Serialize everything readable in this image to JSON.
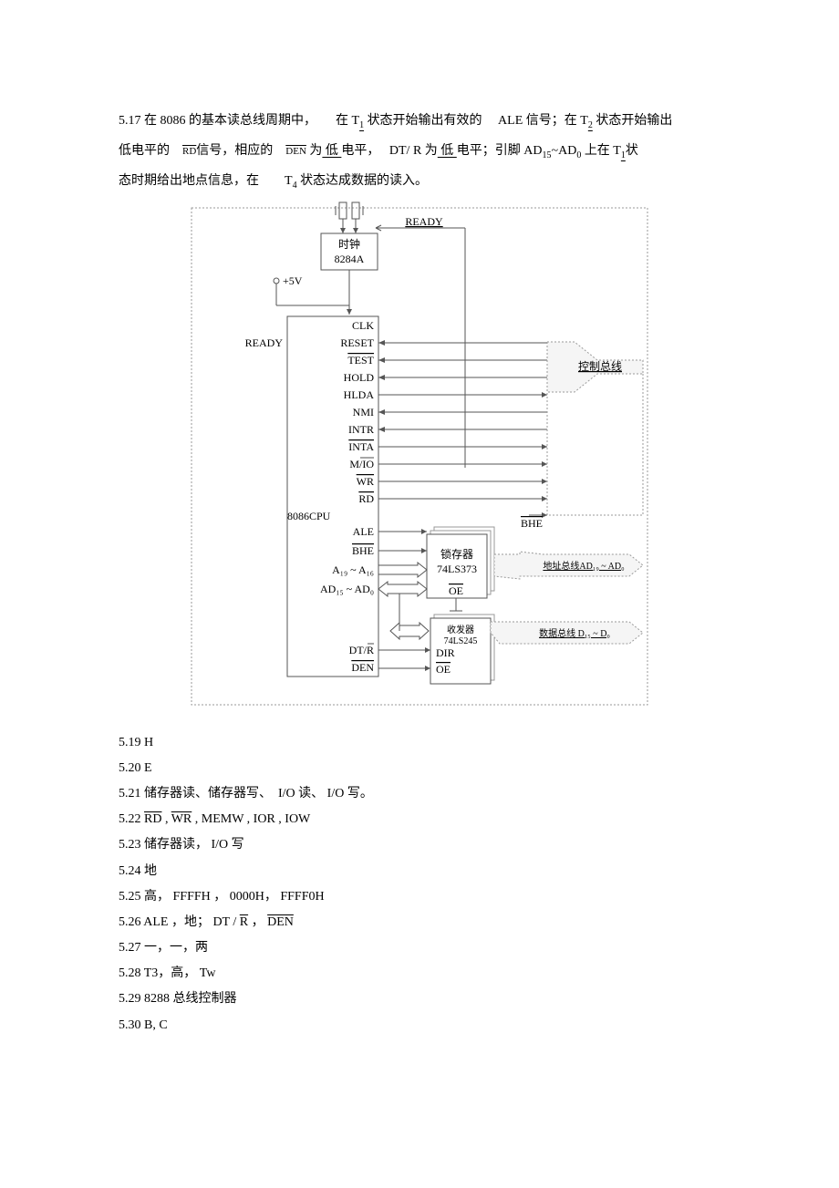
{
  "q517": {
    "prefix": "5.17 在 8086 的基本读总线周期中，　　在 T",
    "t1_sub": "1",
    "mid1": " 状态开始输出有效的　  ALE 信号；在 T",
    "t2_sub": "2",
    "mid1b": " 状态开始输出",
    "line2a": "低电平的　",
    "rd": "RD",
    "line2b": "信号，相应的　",
    "den": "DEN",
    "line2c": " 为",
    "blank1": "   低   ",
    "line2d": "电平，　 DT/ R 为",
    "blank2": "   低   ",
    "line2e": "电平；引脚  AD",
    "ad15": "15",
    "tilde": "~AD",
    "ad0": "0",
    "line2f": " 上在 T",
    "t1b": "1",
    "line2g": "状",
    "line3a": "态时期给出地点信息，在　　T",
    "t4_sub": "4",
    "line3b": " 状态达成数据的读入。"
  },
  "diagram": {
    "ready": "READY",
    "clock": "时钟",
    "clock2": "8284A",
    "v5": "+5V",
    "ready2": "READY",
    "clk": "CLK",
    "reset": "RESET",
    "test": "TEST",
    "hold": "HOLD",
    "hlda": "HLDA",
    "nmi": "NMI",
    "intr": "INTR",
    "inta": "INTA",
    "mio": "M/IO",
    "wr": "WR",
    "rd": "RD",
    "cpu": "8086CPU",
    "ale": "ALE",
    "bhe": "BHE",
    "a19a16": "A₁₉ ~ A₁₆",
    "ad15ad0": "AD₁₅ ~ AD₀",
    "dtr": "DT/R",
    "den": "DEN",
    "latch1": "锁存器",
    "latch2": "74LS373",
    "oe": "OE",
    "trans1": "收发器",
    "trans2": "74LS245",
    "dir": "DIR",
    "oe2": "OE",
    "bhe2": "BHE",
    "bus_ctrl": "控制总线",
    "bus_addr": "地址总线AD₁₉ ~ AD₀",
    "bus_data": "数据总线 D₁₅ ~ D₀"
  },
  "answers": {
    "a519": "5.19 H",
    "a520": "5.20 E",
    "a521": "5.21 储存器读、储存器写、　I/O 读、 I/O 写。",
    "a522_prefix": "5.22 ",
    "a522_rd": "RD",
    "a522_c1": " , ",
    "a522_wr": "WR",
    "a522_rest": " , MEMW , IOR , IOW",
    "a523": "5.23 储存器读，  I/O 写",
    "a524": "5.24 地",
    "a525": "5.25 高， FFFFH ，  0000H， FFFF0H",
    "a526_prefix": "5.26 ALE ，地； DT / ",
    "a526_r": "R",
    "a526_c": " ，  ",
    "a526_den": "DEN",
    "a527": "5.27 一，一，两",
    "a528": "5.28 T3，高，  Tw",
    "a529": "5.29 8288 总线控制器",
    "a530": "5.30 B, C"
  }
}
